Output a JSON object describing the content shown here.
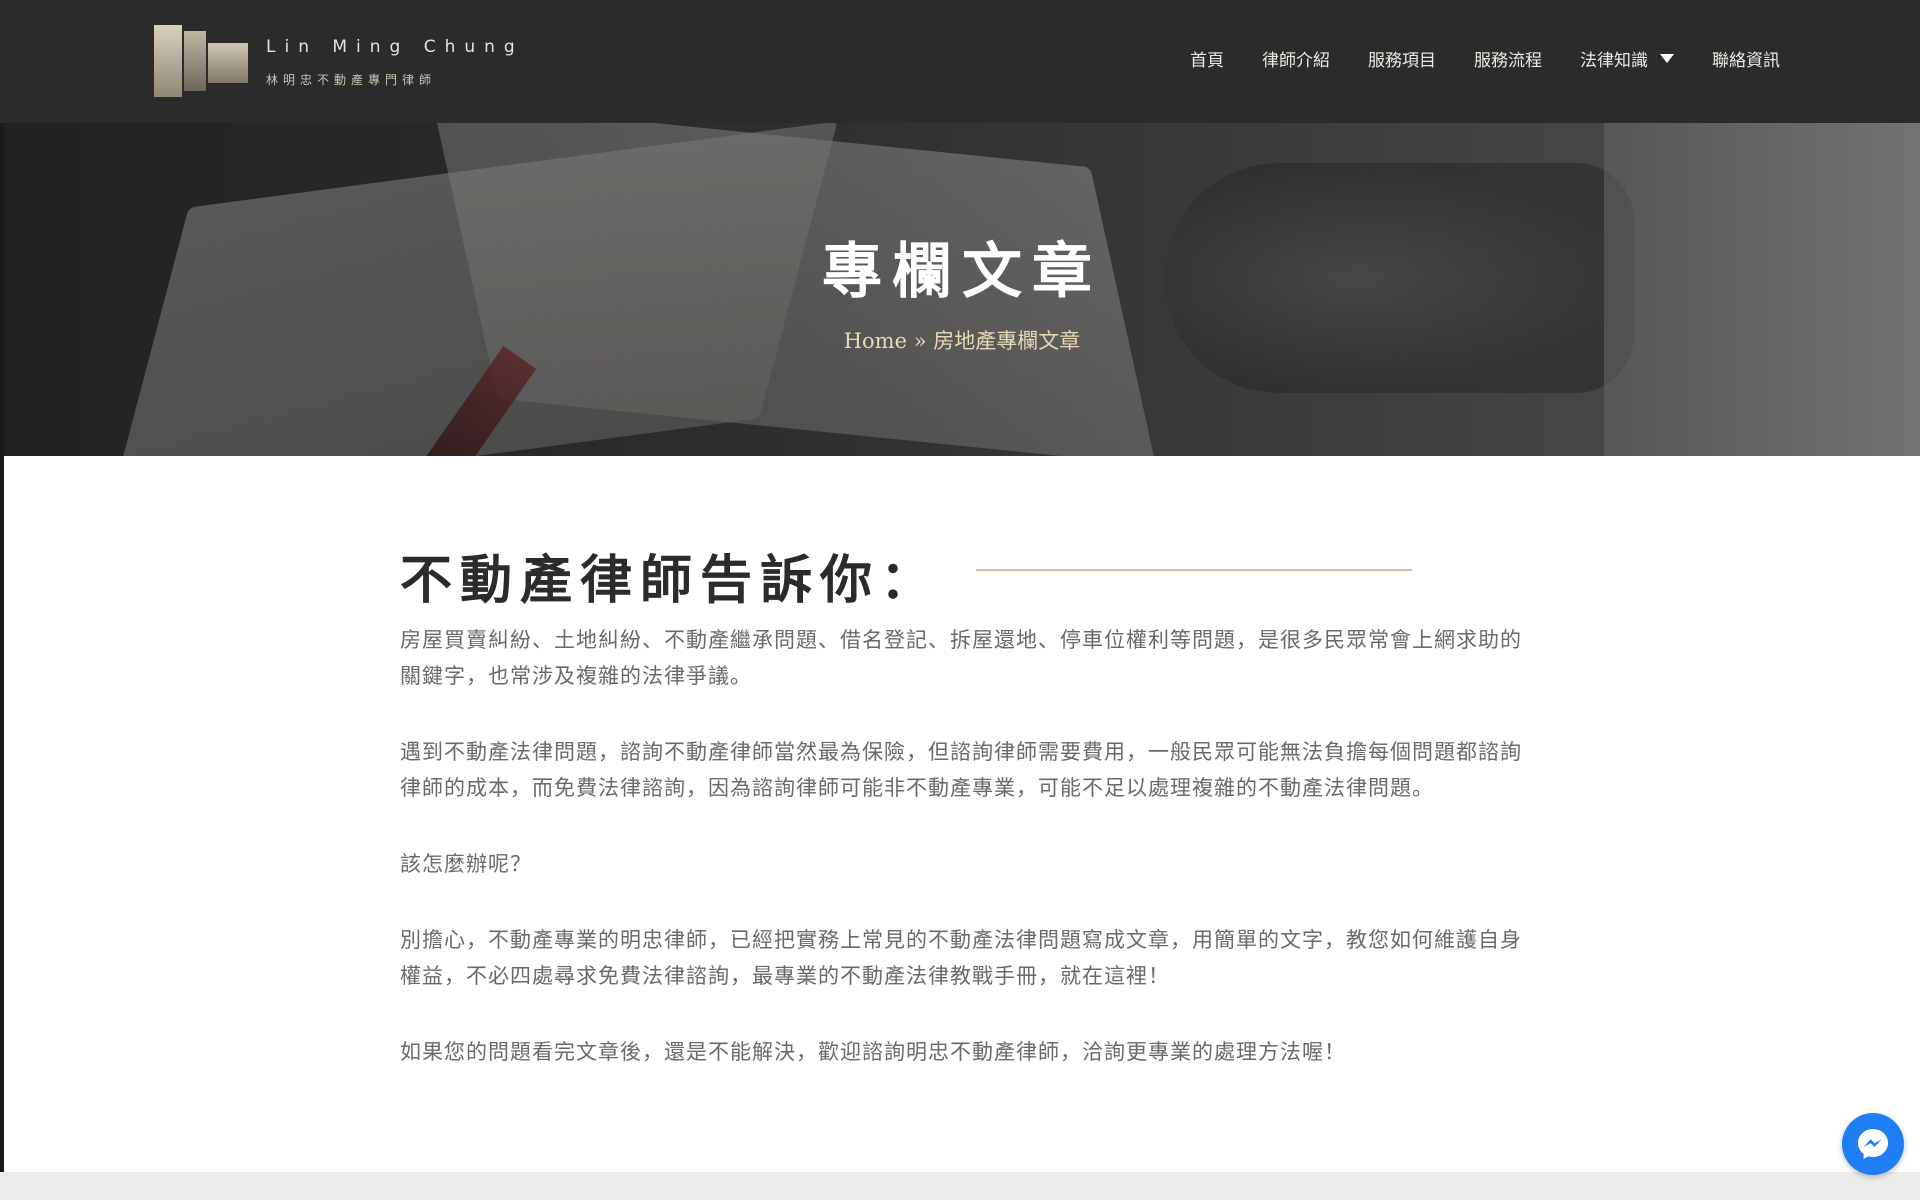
{
  "brand": {
    "name_en": "Lin Ming Chung",
    "name_zh": "林明忠不動產專門律師"
  },
  "nav": {
    "items": [
      {
        "label": "首頁"
      },
      {
        "label": "律師介紹"
      },
      {
        "label": "服務項目"
      },
      {
        "label": "服務流程"
      },
      {
        "label": "法律知識",
        "has_dropdown": true
      },
      {
        "label": "聯絡資訊"
      }
    ]
  },
  "hero": {
    "title": "專欄文章",
    "breadcrumb_home": "Home",
    "breadcrumb_separator": "»",
    "breadcrumb_current": "房地產專欄文章"
  },
  "article": {
    "heading": "不動產律師告訴你：",
    "paragraphs": [
      "房屋買賣糾紛、土地糾紛、不動產繼承問題、借名登記、拆屋還地、停車位權利等問題，是很多民眾常會上網求助的關鍵字，也常涉及複雜的法律爭議。",
      "遇到不動產法律問題，諮詢不動產律師當然最為保險，但諮詢律師需要費用，一般民眾可能無法負擔每個問題都諮詢律師的成本，而免費法律諮詢，因為諮詢律師可能非不動產專業，可能不足以處理複雜的不動產法律問題。",
      "該怎麼辦呢？",
      "別擔心，不動產專業的明忠律師，已經把實務上常見的不動產法律問題寫成文章，用簡單的文字，教您如何維護自身權益，不必四處尋求免費法律諮詢，最專業的不動產法律教戰手冊，就在這裡！",
      "如果您的問題看完文章後，還是不能解決，歡迎諮詢明忠不動產律師，洽詢更專業的處理方法喔！"
    ]
  },
  "colors": {
    "header_bg": "#2b2b2b",
    "accent_gold": "#cdbf9f",
    "messenger_blue": "#1e7ef2"
  },
  "icons": {
    "logo": "logo-mark-icon",
    "dropdown": "caret-down-icon",
    "chat": "messenger-icon"
  }
}
